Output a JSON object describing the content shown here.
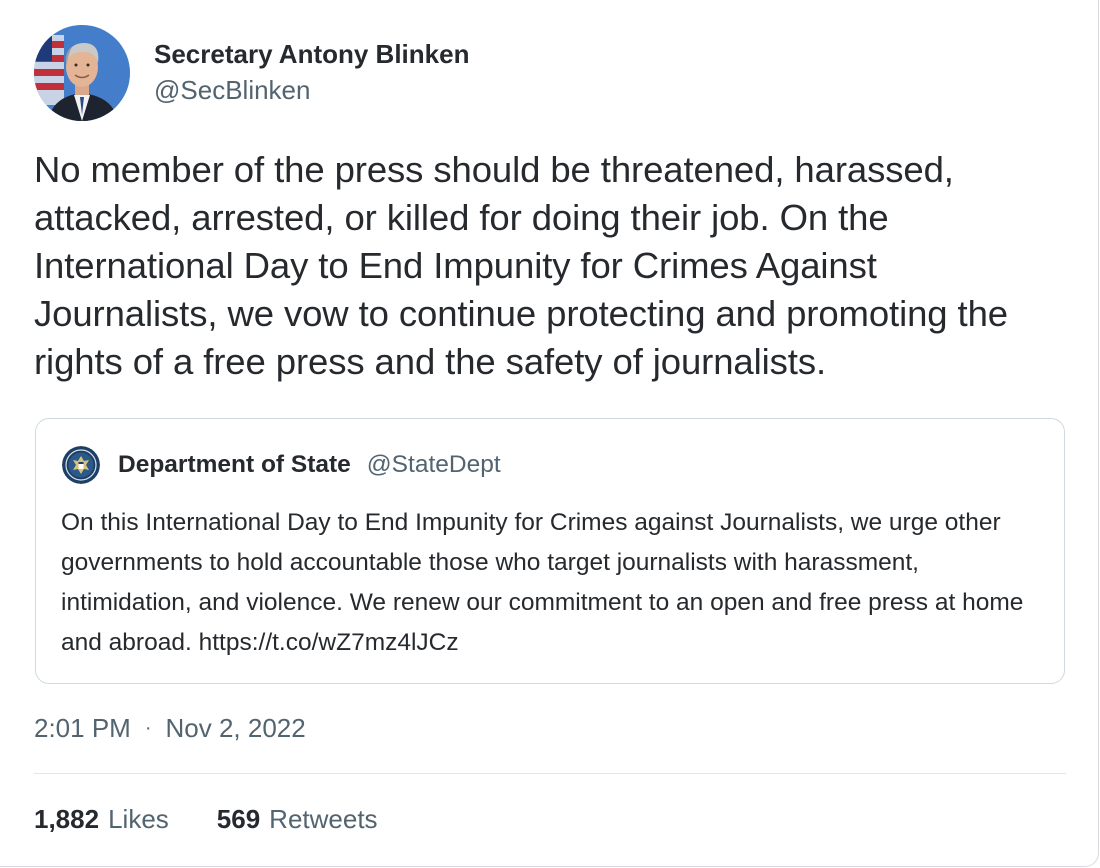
{
  "tweet": {
    "author": {
      "display_name": "Secretary Antony Blinken",
      "handle": "@SecBlinken",
      "avatar_icon": "profile-photo"
    },
    "text": "No member of the press should be threatened, harassed, attacked, arrested, or killed for doing their job. On the International Day to End Impunity for Crimes Against Journalists, we vow to continue protecting and promoting the rights of a free press and the safety of journalists.",
    "quoted": {
      "display_name": "Department of State",
      "handle": "@StateDept",
      "avatar_icon": "state-department-seal",
      "text": "On this International Day to End Impunity for Crimes against Journalists, we urge other governments to hold accountable those who target journalists with harassment, intimidation, and violence. We renew our commitment to an open and free press at home and abroad. https://t.co/wZ7mz4lJCz"
    },
    "time": "2:01 PM",
    "separator": "·",
    "date": "Nov 2, 2022",
    "stats": {
      "likes_count": "1,882",
      "likes_label": "Likes",
      "retweets_count": "569",
      "retweets_label": "Retweets"
    }
  },
  "colors": {
    "text_primary": "#262a2e",
    "text_secondary": "#536471",
    "border": "#cfd9de"
  }
}
